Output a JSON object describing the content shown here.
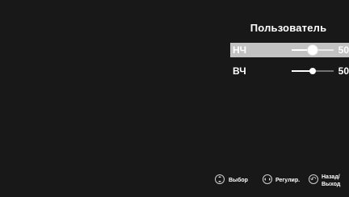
{
  "menu": {
    "title": "Пользователь",
    "items": [
      {
        "label": "НЧ",
        "value": "50",
        "level_percent": 50,
        "selected": true
      },
      {
        "label": "ВЧ",
        "value": "50",
        "level_percent": 50,
        "selected": false
      }
    ]
  },
  "footer": {
    "hints": [
      {
        "icon": "up-down-icon",
        "label": "Выбор"
      },
      {
        "icon": "left-right-icon",
        "label": "Регулир."
      },
      {
        "icon": "return-icon",
        "label_line1": "Назад/",
        "label_line2": "Выход"
      }
    ]
  },
  "colors": {
    "background": "#181818",
    "selection": "#c2c2c2",
    "text": "#ffffff"
  }
}
